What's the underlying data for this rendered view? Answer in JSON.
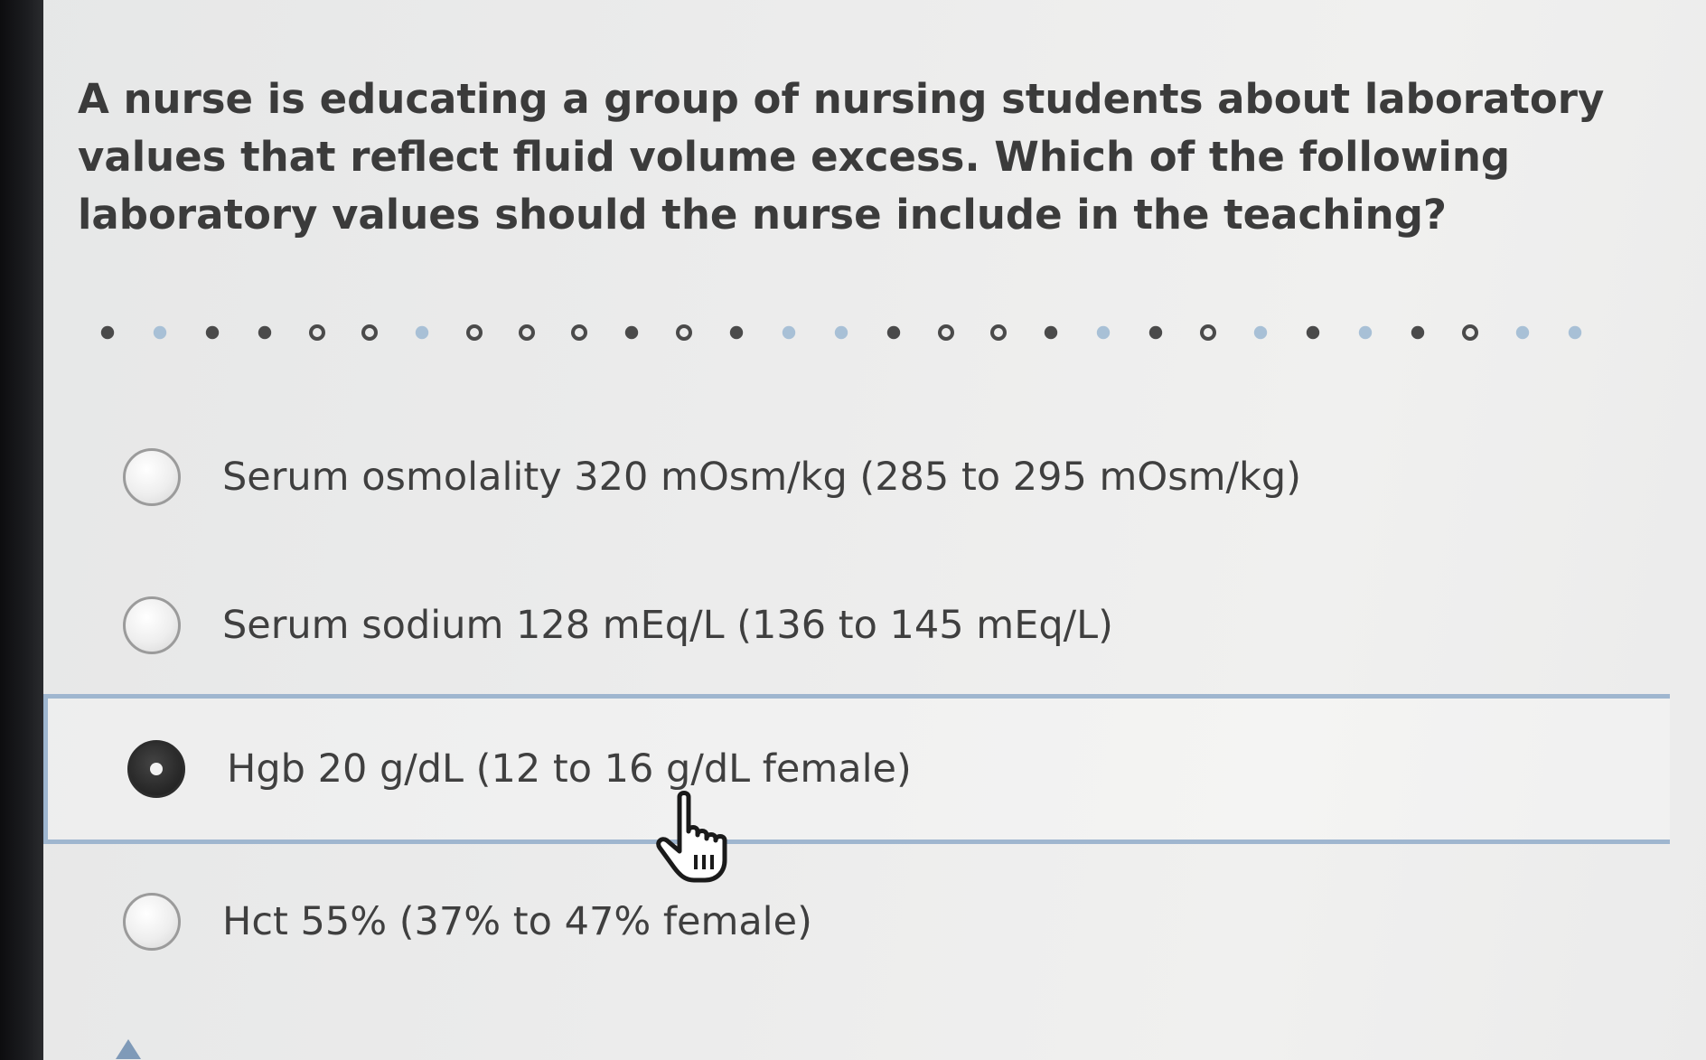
{
  "question": {
    "text": "A nurse is educating a group of nursing students about laboratory values that reflect fluid volume excess. Which of the following laboratory values should the nurse include in the teaching?"
  },
  "progress": {
    "dots": [
      "done",
      "skipped",
      "done",
      "done",
      "open",
      "open",
      "skipped",
      "open",
      "open",
      "open",
      "done",
      "open",
      "done",
      "skipped",
      "skipped",
      "done",
      "open",
      "open",
      "done",
      "skipped",
      "done",
      "open",
      "skipped",
      "done",
      "skipped",
      "done",
      "open",
      "skipped",
      "skipped"
    ]
  },
  "options": [
    {
      "label": "Serum osmolality 320 mOsm/kg (285 to 295 mOsm/kg)",
      "selected": false
    },
    {
      "label": "Serum sodium 128 mEq/L (136 to 145 mEq/L)",
      "selected": false
    },
    {
      "label": "Hgb 20 g/dL (12 to 16 g/dL female)",
      "selected": true
    },
    {
      "label": "Hct 55% (37% to 47% female)",
      "selected": false
    }
  ],
  "colors": {
    "selected_border": "#9fb6cf",
    "text": "#3f3f3f",
    "dot_done": "#4a4a4a",
    "dot_skipped": "#a8c0d6"
  },
  "cursor": {
    "icon": "hand-pointer-icon"
  }
}
